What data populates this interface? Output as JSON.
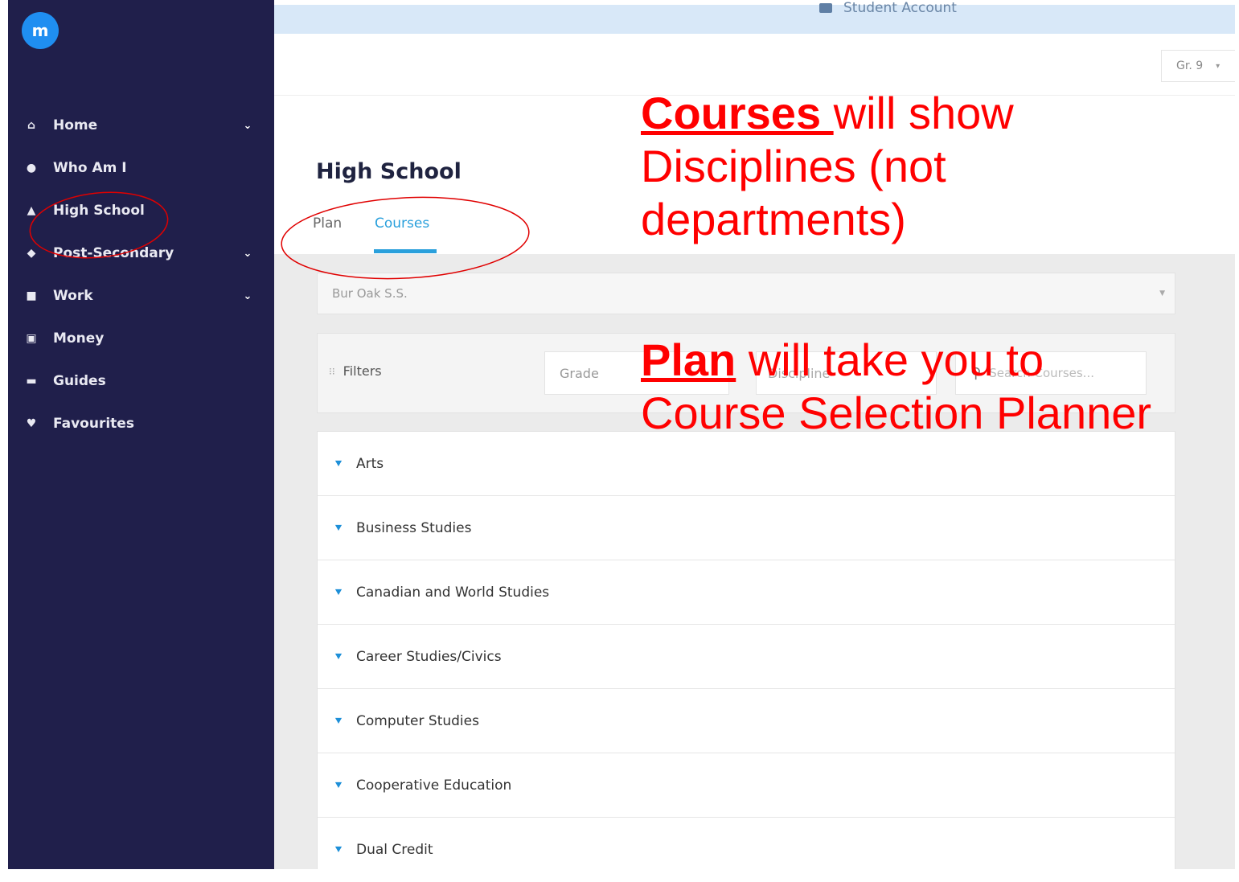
{
  "banner": {
    "text": "Student Account",
    "icon": "account-icon"
  },
  "grade_select": {
    "value": "Gr. 9",
    "caret": "▾"
  },
  "logo": {
    "letter": "m"
  },
  "sidebar": {
    "items": [
      {
        "label": "Home",
        "icon": "home-icon",
        "glyph": "⌂",
        "chevron": "⌄"
      },
      {
        "label": "Who Am I",
        "icon": "person-circle-icon",
        "glyph": "●",
        "chevron": ""
      },
      {
        "label": "High School",
        "icon": "school-icon",
        "glyph": "▲",
        "chevron": ""
      },
      {
        "label": "Post-Secondary",
        "icon": "graduation-cap-icon",
        "glyph": "◆",
        "chevron": "⌄"
      },
      {
        "label": "Work",
        "icon": "briefcase-icon",
        "glyph": "■",
        "chevron": "⌄"
      },
      {
        "label": "Money",
        "icon": "money-icon",
        "glyph": "▣",
        "chevron": ""
      },
      {
        "label": "Guides",
        "icon": "book-icon",
        "glyph": "▬",
        "chevron": ""
      },
      {
        "label": "Favourites",
        "icon": "heart-icon",
        "glyph": "♥",
        "chevron": ""
      }
    ]
  },
  "page": {
    "title": "High School",
    "tabs": [
      {
        "label": "Plan"
      },
      {
        "label": "Courses"
      }
    ]
  },
  "school_select": {
    "value": "Bur Oak S.S."
  },
  "filters": {
    "label": "Filters",
    "grade_placeholder": "Grade",
    "discipline_placeholder": "Discipline",
    "search_placeholder": "Search Courses..."
  },
  "disciplines": [
    "Arts",
    "Business Studies",
    "Canadian and World Studies",
    "Career Studies/Civics",
    "Computer Studies",
    "Cooperative Education",
    "Dual Credit"
  ],
  "annotations": {
    "courses_keyword": "Courses ",
    "courses_rest_1": "will show",
    "courses_line_2": "Disciplines (not",
    "courses_line_3": "departments)",
    "plan_keyword": "Plan",
    "plan_rest_1": " will take you to",
    "plan_line_2": "Course Selection Planner",
    "color": "#ff0000"
  },
  "colors": {
    "sidebar": "#201f4b",
    "accent": "#2aa0dc",
    "banner": "#d8e8f8"
  }
}
